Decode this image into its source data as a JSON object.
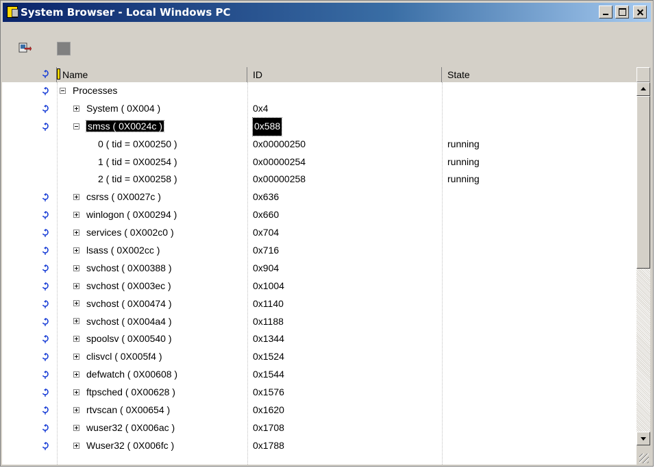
{
  "window": {
    "title": "System Browser - Local Windows PC"
  },
  "toolbar": {
    "browse_icon": "refresh-browse-icon",
    "stop_icon": "stop-icon"
  },
  "columns": {
    "name": "Name",
    "id": "ID",
    "state": "State"
  },
  "colors": {
    "indicator": "#1a3fd6",
    "selection_bg": "#000000",
    "title_start": "#0a246a",
    "title_end": "#a6caf0"
  },
  "rows": [
    {
      "level": 0,
      "toggle": "minus",
      "label": "Processes",
      "id": "",
      "state": "",
      "indicator": true,
      "selected": false
    },
    {
      "level": 1,
      "toggle": "plus",
      "label": "System ( 0X004 )",
      "id": "0x4",
      "state": "",
      "indicator": true,
      "selected": false
    },
    {
      "level": 1,
      "toggle": "minus",
      "label": "smss ( 0X0024c )",
      "id": "0x588",
      "state": "",
      "indicator": true,
      "selected": true
    },
    {
      "level": 2,
      "toggle": "none",
      "label": "0 ( tid = 0X00250 )",
      "id": "0x00000250",
      "state": "running",
      "indicator": false,
      "selected": false
    },
    {
      "level": 2,
      "toggle": "none",
      "label": "1 ( tid = 0X00254 )",
      "id": "0x00000254",
      "state": "running",
      "indicator": false,
      "selected": false
    },
    {
      "level": 2,
      "toggle": "none",
      "label": "2 ( tid = 0X00258 )",
      "id": "0x00000258",
      "state": "running",
      "indicator": false,
      "selected": false
    },
    {
      "level": 1,
      "toggle": "plus",
      "label": "csrss ( 0X0027c )",
      "id": "0x636",
      "state": "",
      "indicator": true,
      "selected": false
    },
    {
      "level": 1,
      "toggle": "plus",
      "label": "winlogon ( 0X00294 )",
      "id": "0x660",
      "state": "",
      "indicator": true,
      "selected": false
    },
    {
      "level": 1,
      "toggle": "plus",
      "label": "services ( 0X002c0 )",
      "id": "0x704",
      "state": "",
      "indicator": true,
      "selected": false
    },
    {
      "level": 1,
      "toggle": "plus",
      "label": "lsass ( 0X002cc )",
      "id": "0x716",
      "state": "",
      "indicator": true,
      "selected": false
    },
    {
      "level": 1,
      "toggle": "plus",
      "label": "svchost ( 0X00388 )",
      "id": "0x904",
      "state": "",
      "indicator": true,
      "selected": false
    },
    {
      "level": 1,
      "toggle": "plus",
      "label": "svchost ( 0X003ec )",
      "id": "0x1004",
      "state": "",
      "indicator": true,
      "selected": false
    },
    {
      "level": 1,
      "toggle": "plus",
      "label": "svchost ( 0X00474 )",
      "id": "0x1140",
      "state": "",
      "indicator": true,
      "selected": false
    },
    {
      "level": 1,
      "toggle": "plus",
      "label": "svchost ( 0X004a4 )",
      "id": "0x1188",
      "state": "",
      "indicator": true,
      "selected": false
    },
    {
      "level": 1,
      "toggle": "plus",
      "label": "spoolsv ( 0X00540 )",
      "id": "0x1344",
      "state": "",
      "indicator": true,
      "selected": false
    },
    {
      "level": 1,
      "toggle": "plus",
      "label": "clisvcl ( 0X005f4 )",
      "id": "0x1524",
      "state": "",
      "indicator": true,
      "selected": false
    },
    {
      "level": 1,
      "toggle": "plus",
      "label": "defwatch ( 0X00608 )",
      "id": "0x1544",
      "state": "",
      "indicator": true,
      "selected": false
    },
    {
      "level": 1,
      "toggle": "plus",
      "label": "ftpsched ( 0X00628 )",
      "id": "0x1576",
      "state": "",
      "indicator": true,
      "selected": false
    },
    {
      "level": 1,
      "toggle": "plus",
      "label": "rtvscan ( 0X00654 )",
      "id": "0x1620",
      "state": "",
      "indicator": true,
      "selected": false
    },
    {
      "level": 1,
      "toggle": "plus",
      "label": "wuser32 ( 0X006ac )",
      "id": "0x1708",
      "state": "",
      "indicator": true,
      "selected": false
    },
    {
      "level": 1,
      "toggle": "plus",
      "label": "Wuser32 ( 0X006fc )",
      "id": "0x1788",
      "state": "",
      "indicator": true,
      "selected": false
    }
  ]
}
